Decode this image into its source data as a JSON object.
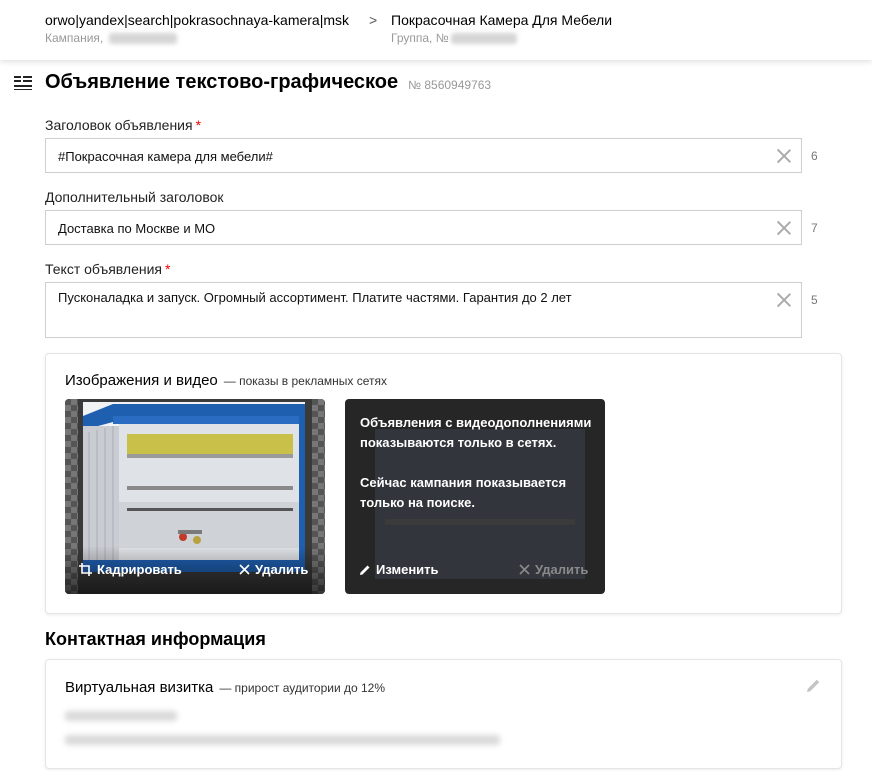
{
  "breadcrumb": {
    "campaign": {
      "name": "orwo|yandex|search|pokrasochnaya-kamera|msk",
      "label": "Кампания,"
    },
    "separator": ">",
    "group": {
      "name": "Покрасочная Камера Для Мебели",
      "label": "Группа, №"
    }
  },
  "ad": {
    "title": "Объявление текстово-графическое",
    "number": "№ 8560949763"
  },
  "fields": {
    "headline": {
      "label": "Заголовок объявления",
      "required": "*",
      "value": "#Покрасочная камера для мебели#",
      "counter": "6"
    },
    "extra_headline": {
      "label": "Дополнительный заголовок",
      "value": "Доставка по Москве и МО",
      "counter": "7"
    },
    "text": {
      "label": "Текст объявления",
      "required": "*",
      "value": "Пусконаладка и запуск. Огромный ассортимент. Платите частями. Гарантия до 2 лет",
      "counter": "5"
    }
  },
  "media": {
    "title": "Изображения и видео",
    "subtitle": "— показы в рекламных сетях",
    "image_tile": {
      "crop_label": "Кадрировать",
      "delete_label": "Удалить"
    },
    "video_tile": {
      "note_line1": "Объявления с видеодополнениями показываются только в сетях.",
      "note_line2": "Сейчас кампания показывается только на поиске.",
      "edit_label": "Изменить",
      "delete_label": "Удалить"
    }
  },
  "contact": {
    "section_title": "Контактная информация",
    "card_title": "Виртуальная визитка",
    "card_subtitle": "— прирост аудитории до 12%"
  },
  "colors": {
    "required": "#ee0000",
    "border": "#cfcfcf",
    "muted": "#999999"
  },
  "icons": [
    "menu-icon",
    "clear-icon",
    "crop-icon",
    "close-icon",
    "pencil-icon"
  ]
}
